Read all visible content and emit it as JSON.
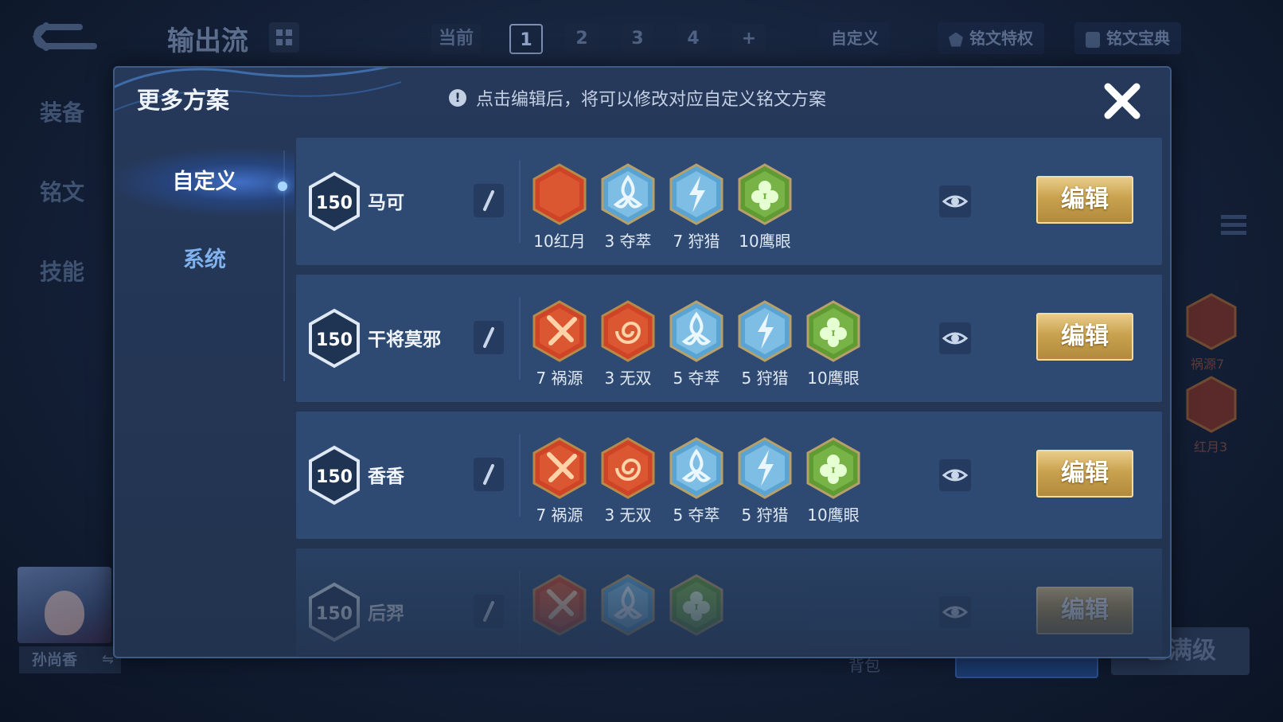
{
  "background": {
    "loadout_name": "输出流",
    "page_tabs": [
      {
        "label": "当前",
        "active": false
      },
      {
        "label": "1",
        "active": true
      },
      {
        "label": "2",
        "active": false
      },
      {
        "label": "3",
        "active": false
      },
      {
        "label": "4",
        "active": false
      },
      {
        "label": "+",
        "active": false
      }
    ],
    "custom_label": "自定义",
    "rune_privilege": "铭文特权",
    "rune_codex": "铭文宝典",
    "side_nav": [
      "装备",
      "铭文",
      "技能"
    ],
    "hero_name": "孙尚香",
    "swap_symbol": "⇋",
    "right_runes": [
      "祸源7",
      "红月3"
    ],
    "bag_label": "背包",
    "bottom_right_label": "已满级"
  },
  "modal": {
    "title": "更多方案",
    "hint": "点击编辑后，将可以修改对应自定义铭文方案",
    "hint_icon": "exclamation-icon",
    "close_icon": "close-icon",
    "tabs": [
      {
        "label": "自定义",
        "active": true
      },
      {
        "label": "系统",
        "active": false
      }
    ],
    "edit_label": "编辑",
    "rows": [
      {
        "level": "150",
        "name": "马可",
        "runes": [
          {
            "label": "10红月",
            "color": "red",
            "icon": "crescent-moon-icon"
          },
          {
            "label": "3 夺萃",
            "color": "blue",
            "icon": "triquetra-icon"
          },
          {
            "label": "7 狩猎",
            "color": "blue",
            "icon": "lightning-icon"
          },
          {
            "label": "10鹰眼",
            "color": "green",
            "icon": "clover-icon"
          }
        ]
      },
      {
        "level": "150",
        "name": "干将莫邪",
        "runes": [
          {
            "label": "7 祸源",
            "color": "red",
            "icon": "blade-icon"
          },
          {
            "label": "3 无双",
            "color": "red",
            "icon": "swirl-icon"
          },
          {
            "label": "5 夺萃",
            "color": "blue",
            "icon": "triquetra-icon"
          },
          {
            "label": "5 狩猎",
            "color": "blue",
            "icon": "lightning-icon"
          },
          {
            "label": "10鹰眼",
            "color": "green",
            "icon": "clover-icon"
          }
        ]
      },
      {
        "level": "150",
        "name": "香香",
        "runes": [
          {
            "label": "7 祸源",
            "color": "red",
            "icon": "blade-icon"
          },
          {
            "label": "3 无双",
            "color": "red",
            "icon": "swirl-icon"
          },
          {
            "label": "5 夺萃",
            "color": "blue",
            "icon": "triquetra-icon"
          },
          {
            "label": "5 狩猎",
            "color": "blue",
            "icon": "lightning-icon"
          },
          {
            "label": "10鹰眼",
            "color": "green",
            "icon": "clover-icon"
          }
        ]
      },
      {
        "level": "150",
        "name": "后羿",
        "runes": [
          {
            "label": "",
            "color": "red",
            "icon": "blade-icon"
          },
          {
            "label": "",
            "color": "blue",
            "icon": "triquetra-icon"
          },
          {
            "label": "",
            "color": "green",
            "icon": "clover-icon"
          }
        ]
      }
    ]
  },
  "colors": {
    "red_rune": "#d2452a",
    "blue_rune": "#5fa9d8",
    "green_rune": "#6fae3a",
    "gold_button": "#c9a24f",
    "accent_blue": "#7fb2ee"
  }
}
